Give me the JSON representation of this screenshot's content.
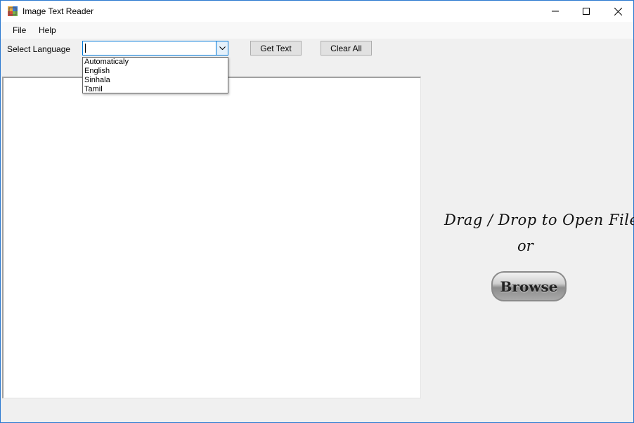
{
  "window": {
    "title": "Image Text Reader"
  },
  "menu": {
    "items": [
      {
        "label": "File"
      },
      {
        "label": "Help"
      }
    ]
  },
  "form": {
    "language_label": "Select Language",
    "language_value": "",
    "language_options": [
      "Automaticaly",
      "English",
      "Sinhala",
      "Tamil"
    ],
    "get_text_label": "Get Text",
    "clear_all_label": "Clear All"
  },
  "drop_zone": {
    "instruction": "Drag / Drop to Open File",
    "or_text": "or",
    "browse_label": "Browse"
  },
  "colors": {
    "accent": "#0078d7",
    "window_border": "#2b79d0",
    "background": "#f0f0f0"
  },
  "icons": [
    "app-icon",
    "minimize-icon",
    "maximize-icon",
    "close-icon",
    "chevron-down-icon"
  ]
}
